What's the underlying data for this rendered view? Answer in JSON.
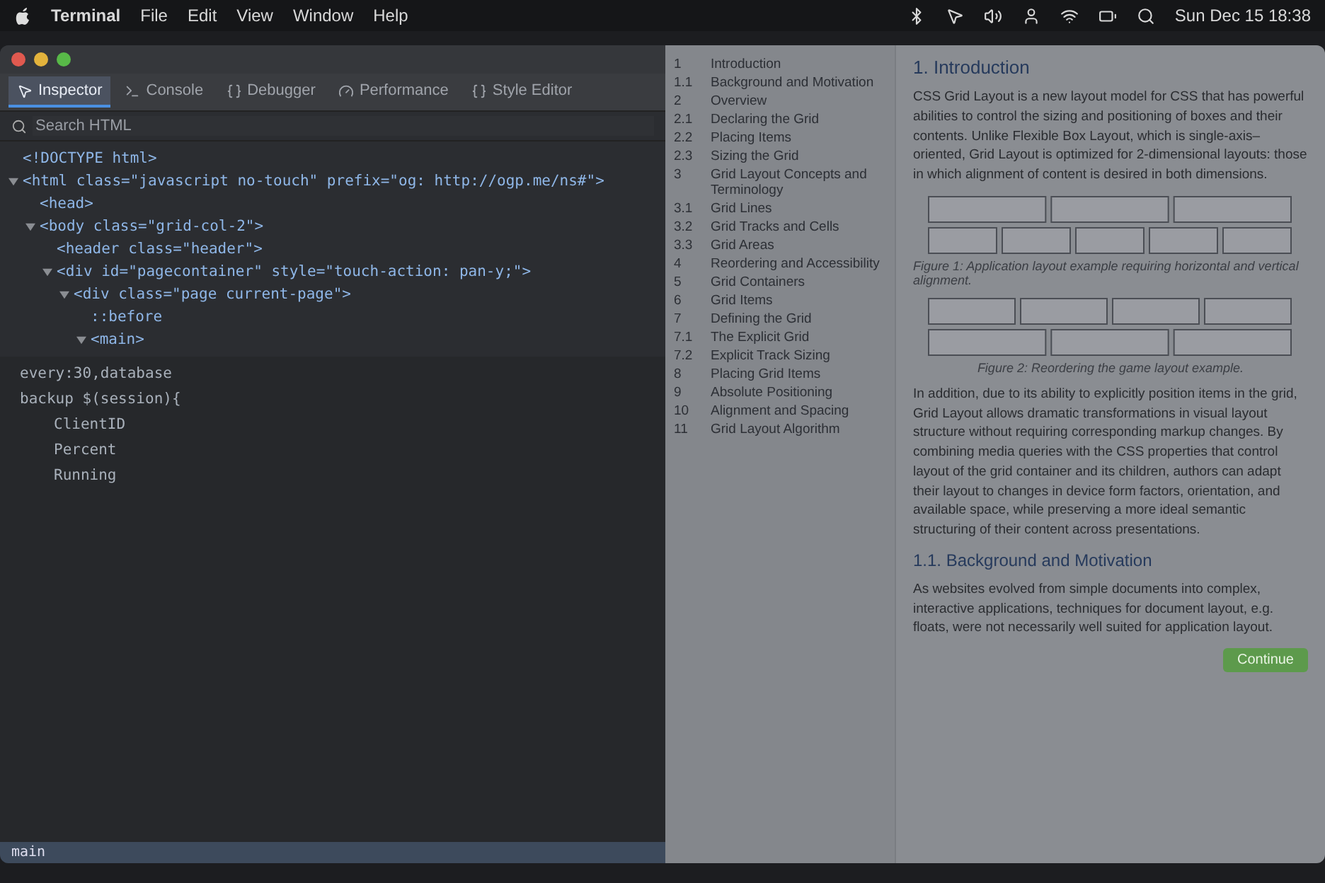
{
  "menu_bar": {
    "menus": [
      "Terminal",
      "File",
      "Edit",
      "View",
      "Window",
      "Help"
    ],
    "clock": "Sun Dec 15  18:38"
  },
  "devtools": {
    "tabs": [
      {
        "label": "Inspector",
        "selected": true
      },
      {
        "label": "Console",
        "selected": false
      },
      {
        "label": "Debugger",
        "selected": false
      },
      {
        "label": "Performance",
        "selected": false
      },
      {
        "label": "Style Editor",
        "selected": false
      }
    ],
    "search": {
      "placeholder": "Search HTML"
    },
    "tree": [
      {
        "text": "<!DOCTYPE html>"
      },
      {
        "text": "<html class=\"javascript no-touch\" prefix=\"og: http://ogp.me/ns#\">",
        "expanded": true,
        "children": [
          {
            "text": "<head>"
          },
          {
            "text": "<body class=\"grid-col-2\">",
            "expanded": true,
            "children": [
              {
                "text": "<header class=\"header\">"
              },
              {
                "text": "<div id=\"pagecontainer\" style=\"touch-action: pan-y;\">",
                "expanded": true,
                "children": [
                  {
                    "text": "<div class=\"page current-page\">",
                    "expanded": true,
                    "children": [
                      {
                        "text": "::before"
                      },
                      {
                        "text": "<main>",
                        "expanded": true
                      }
                    ]
                  }
                ]
              }
            ]
          }
        ]
      }
    ],
    "code": [
      "every:30,database",
      "backup $(session){",
      "ClientID",
      "Percent",
      "Running"
    ],
    "status": "main"
  },
  "document": {
    "toc": [
      {
        "number": "1",
        "title": "Introduction"
      },
      {
        "number": "1.1",
        "title": "Background and Motivation"
      },
      {
        "number": "2",
        "title": "Overview"
      },
      {
        "number": "2.1",
        "title": "Declaring the Grid"
      },
      {
        "number": "2.2",
        "title": "Placing Items"
      },
      {
        "number": "2.3",
        "title": "Sizing the Grid"
      },
      {
        "number": "3",
        "title": "Grid Layout Concepts and Terminology"
      },
      {
        "number": "3.1",
        "title": "Grid Lines"
      },
      {
        "number": "3.2",
        "title": "Grid Tracks and Cells"
      },
      {
        "number": "3.3",
        "title": "Grid Areas"
      },
      {
        "number": "4",
        "title": "Reordering and Accessibility"
      },
      {
        "number": "5",
        "title": "Grid Containers"
      },
      {
        "number": "6",
        "title": "Grid Items"
      },
      {
        "number": "7",
        "title": "Defining the Grid"
      },
      {
        "number": "7.1",
        "title": "The Explicit Grid"
      },
      {
        "number": "7.2",
        "title": "Explicit Track Sizing"
      },
      {
        "number": "8",
        "title": "Placing Grid Items"
      },
      {
        "number": "9",
        "title": "Absolute Positioning"
      },
      {
        "number": "10",
        "title": "Alignment and Spacing"
      },
      {
        "number": "11",
        "title": "Grid Layout Algorithm"
      }
    ],
    "heading": "1. Introduction",
    "paragraphs": [
      "CSS Grid Layout is a new layout model for CSS that has powerful abilities to control the sizing and positioning of boxes and their contents. Unlike Flexible Box Layout, which is single-axis–oriented, Grid Layout is optimized for 2-dimensional layouts: those in which alignment of content is desired in both dimensions.",
      "In addition, due to its ability to explicitly position items in the grid, Grid Layout allows dramatic transformations in visual layout structure without requiring corresponding markup changes. By combining media queries with the CSS properties that control layout of the grid container and its children, authors can adapt their layout to changes in device form factors, orientation, and available space, while preserving a more ideal semantic structuring of their content across presentations."
    ],
    "figures": [
      {
        "caption": "Figure 1: Application layout example requiring horizontal and vertical alignment."
      },
      {
        "caption": "Figure 2: Reordering the game layout example."
      }
    ],
    "subheading": "1.1. Background and Motivation",
    "body": "As websites evolved from simple documents into complex, interactive applications, techniques for document layout, e.g. floats, were not necessarily well suited for application layout.",
    "continue_button": "Continue"
  }
}
